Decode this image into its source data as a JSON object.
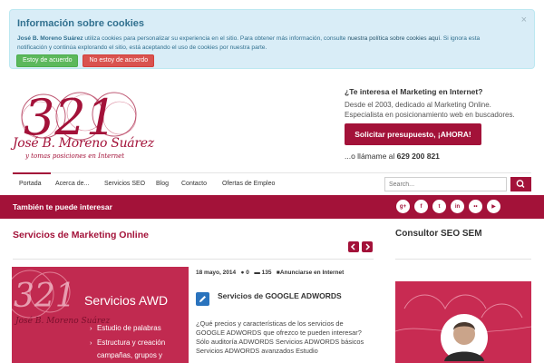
{
  "cookie": {
    "title": "Información sobre cookies",
    "owner": "José B. Moreno Suárez",
    "text_1": " utiliza cookies para personalizar su experiencia en el sitio. Para obtener más información, consulte ",
    "link": "nuestra política sobre cookies aquí",
    "text_2": ". Si ignora esta notificación y continúa explorando el sitio, está aceptando el uso de cookies por nuestra parte.",
    "accept_label": "Estoy de acuerdo",
    "reject_label": "No estoy de acuerdo",
    "close_symbol": "×"
  },
  "logo": {
    "number": "321",
    "name": "José B. Moreno Suárez",
    "tagline": "y tomas posiciones en Internet"
  },
  "promo": {
    "question": "¿Te interesa el Marketing en Internet?",
    "text": "Desde el 2003, dedicado al Marketing Online. Especialista en posicionamiento web en buscadores.",
    "button": "Solicitar presupuesto, ¡AHORA!",
    "call_prefix": "...o llámame al ",
    "phone": "629 200 821"
  },
  "nav": {
    "items": [
      "Portada",
      "Acerca de...",
      "Servicios SEO",
      "Blog",
      "Contacto",
      "Ofertas de Empleo"
    ],
    "search_placeholder": "Search..."
  },
  "interest": {
    "label": "También te puede interesar",
    "social_icons": [
      "google-plus-icon",
      "facebook-icon",
      "twitter-icon",
      "linkedin-icon",
      "flickr-icon",
      "youtube-icon"
    ]
  },
  "main": {
    "section_title": "Servicios de Marketing Online",
    "image": {
      "number": "321",
      "heading": "Servicios AWD",
      "lines": [
        "Estudio de palabras",
        "Estructura y creación",
        "campañas, grupos y"
      ],
      "name": "José B. Moreno Suárez"
    },
    "post": {
      "date": "18 mayo, 2014",
      "comments": "0",
      "views": "135",
      "category": "Anunciarse en Internet",
      "title": "Servicios de GOOGLE ADWORDS",
      "excerpt": "¿Qué precios y características de los servicios de GOOGLE ADWORDS que ofrezco te pueden interesar? Sólo auditoría ADWORDS Servicios ADWORDS básicos Servicios ADWORDS avanzados Estudio"
    }
  },
  "sidebar": {
    "title": "Consultor SEO SEM"
  },
  "colors": {
    "brand": "#a31239",
    "cookie_bg": "#d9edf7",
    "accept": "#5cb85c",
    "reject": "#d9534f"
  }
}
